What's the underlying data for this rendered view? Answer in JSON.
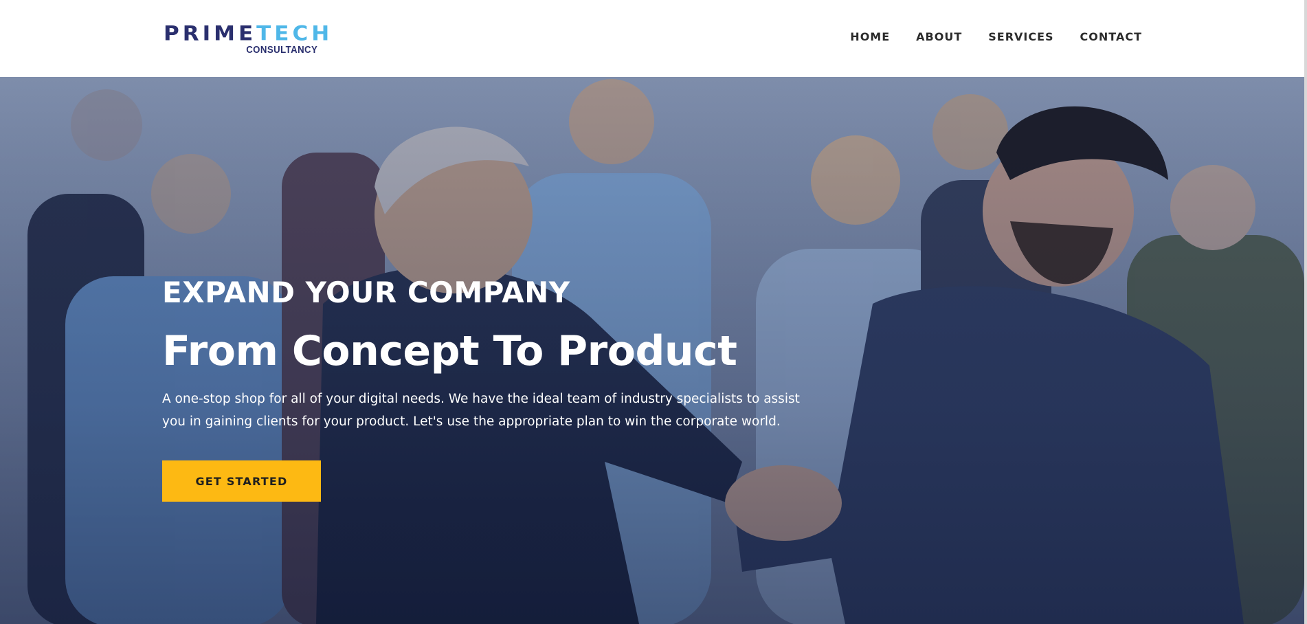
{
  "header": {
    "logo": {
      "main_prime": "PRIME",
      "main_tech": "TECH",
      "sub": "CONSULTANCY"
    },
    "nav": [
      {
        "label": "HOME"
      },
      {
        "label": "ABOUT"
      },
      {
        "label": "SERVICES"
      },
      {
        "label": "CONTACT"
      }
    ]
  },
  "hero": {
    "kicker": "EXPAND YOUR COMPANY",
    "headline": "From Concept To Product",
    "description": "A one-stop shop for all of your digital needs. We have the ideal team of industry specialists to assist you in gaining clients for your product. Let's use the appropriate plan to win the corporate world.",
    "cta_label": "GET STARTED",
    "image_icon": "business-handshake-photo"
  },
  "colors": {
    "brand_dark": "#2a2f6e",
    "brand_light": "#4fb7e8",
    "accent": "#fdb913",
    "nav_text": "#2b2b2b"
  }
}
